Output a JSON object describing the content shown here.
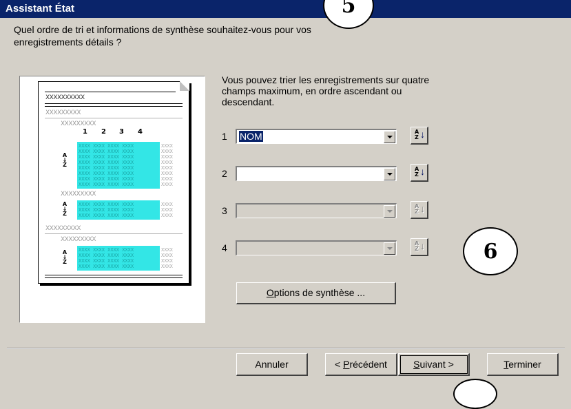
{
  "window": {
    "title": "Assistant État"
  },
  "badges": {
    "top": "5",
    "right": "6"
  },
  "question": {
    "line1": "Quel ordre de tri et informations de synthèse souhaitez-vous pour vos",
    "line2": "enregistrements détails ?"
  },
  "preview": {
    "header_text": "XXXXXXXXXX",
    "group_text": "XXXXXXXXX",
    "columns": [
      "1",
      "2",
      "3",
      "4"
    ],
    "cell_text": "XXXX",
    "sort_glyph_top": "A",
    "sort_glyph_bottom": "Z"
  },
  "info": {
    "line1": "Vous pouvez trier les enregistrements sur quatre",
    "line2": "champs maximum, en ordre ascendant ou",
    "line3": "descendant."
  },
  "sort_fields": [
    {
      "number": "1",
      "value": "NOM",
      "enabled": true
    },
    {
      "number": "2",
      "value": "",
      "enabled": true
    },
    {
      "number": "3",
      "value": "",
      "enabled": false
    },
    {
      "number": "4",
      "value": "",
      "enabled": false
    }
  ],
  "buttons": {
    "options": {
      "mnemonic": "O",
      "rest": "ptions de synthèse ..."
    },
    "cancel": "Annuler",
    "previous": {
      "prefix": "< ",
      "mnemonic": "P",
      "rest": "récédent"
    },
    "next": {
      "mnemonic": "S",
      "rest": "uivant >"
    },
    "finish": {
      "mnemonic": "T",
      "rest": "erminer"
    }
  },
  "icons": {
    "sort_button": "sort-ascending-icon",
    "dropdown": "chevron-down-icon"
  },
  "colors": {
    "titlebar": "#0a246a",
    "highlight": "#33e6e6",
    "face": "#d4d0c8"
  }
}
